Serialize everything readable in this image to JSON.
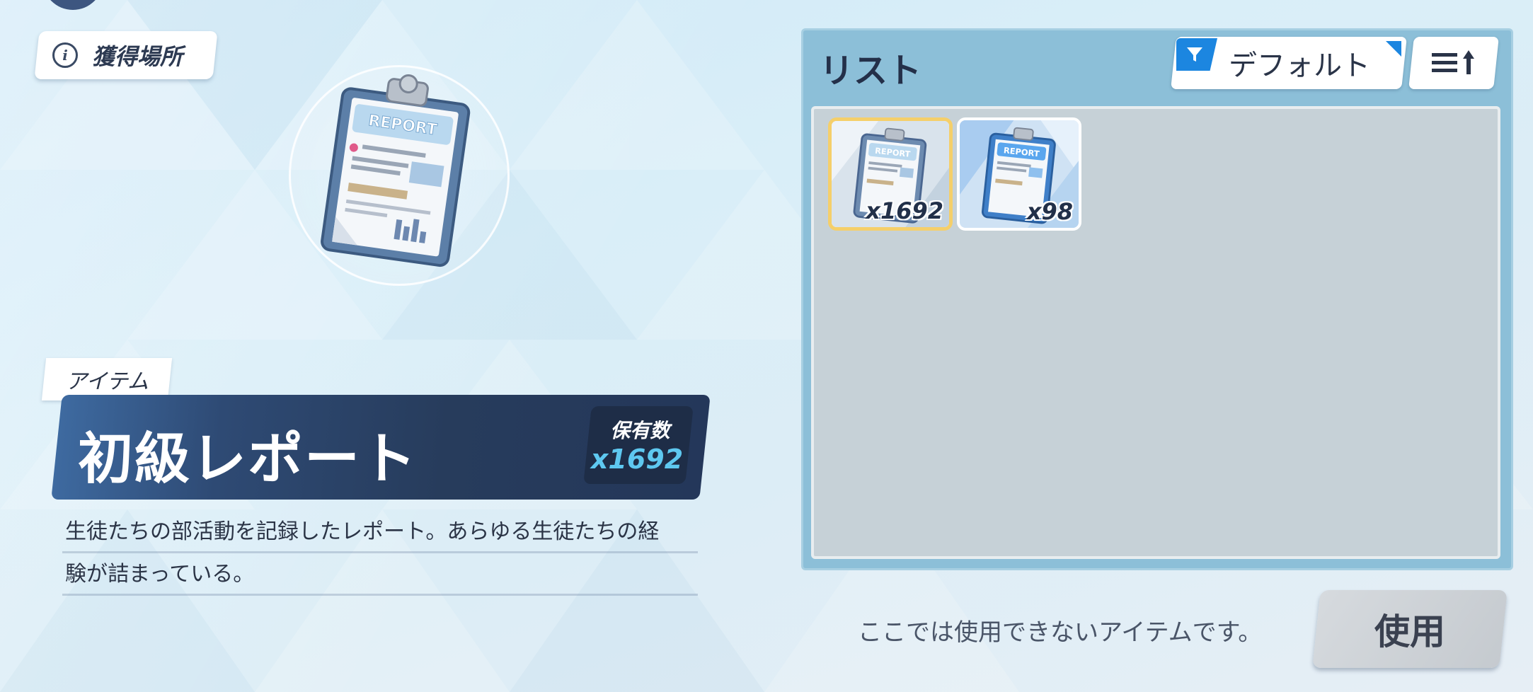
{
  "source_button": {
    "label": "獲得場所",
    "icon": "info-icon"
  },
  "item_detail": {
    "category": "アイテム",
    "name": "初級レポート",
    "owned_label": "保有数",
    "owned_count": "x1692",
    "description_lines": [
      "生徒たちの部活動を記録したレポート。あらゆる生徒たちの経",
      "験が詰まっている。"
    ]
  },
  "list_panel": {
    "title": "リスト",
    "filter_label": "デフォルト",
    "filter_icon": "filter-icon",
    "sort_icon": "sort-ascending-icon",
    "items": [
      {
        "count": "x1692",
        "rarity_color": "#f5cf6a",
        "icon": "report-clipboard-icon",
        "selected": true
      },
      {
        "count": "x98",
        "rarity_color": "#ffffff",
        "icon": "report-clipboard-icon",
        "selected": false
      }
    ]
  },
  "footer": {
    "status_message": "ここでは使用できないアイテムです。",
    "use_label": "使用"
  },
  "colors": {
    "banner_dark": "#24375a",
    "owned_count": "#5ec8f0",
    "accent_blue": "#1c86e0",
    "selected_border": "#f5cf6a"
  }
}
